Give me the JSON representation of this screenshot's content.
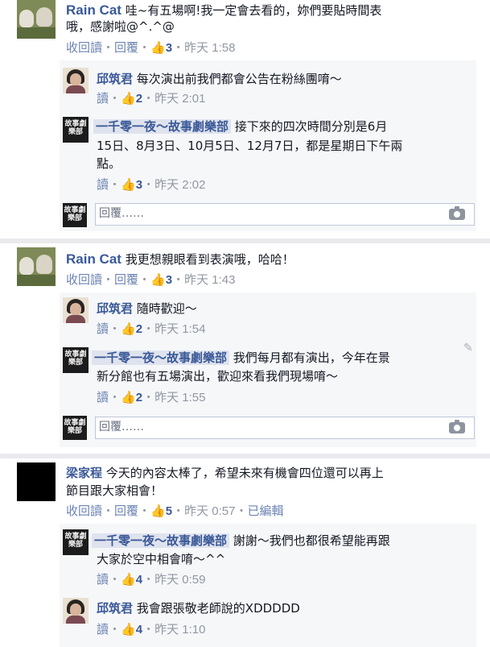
{
  "labels": {
    "reply_link": "回覆",
    "read": "讀",
    "receipt_prefix": "收回讀",
    "dot": "・",
    "edited": "已編輯",
    "reply_placeholder": "回覆……",
    "pencil_icon": "pencil-icon",
    "camera_icon": "camera-icon",
    "like_icon": "thumbs-up-icon"
  },
  "logo_text": "故事劇樂部",
  "threads": [
    {
      "author": "Rain Cat",
      "text_line1": "哇~有五場啊!我一定會去看的，妳們要貼時間表",
      "text_line2": "哦，感謝啦@^.^@",
      "likes": "3",
      "time": "昨天 1:58",
      "replies": [
        {
          "author": "邱筑君",
          "text": "每次演出前我們都會公告在粉絲團唷～",
          "likes": "2",
          "time": "昨天 2:01"
        },
        {
          "author": "一千零一夜～故事劇樂部",
          "text_line1": "接下來的四次時間分別是6月",
          "text_line2": "15日、8月3日、10月5日、12月7日，都是星期日下午兩",
          "text_line3": "點。",
          "likes": "3",
          "time": "昨天 2:02"
        }
      ]
    },
    {
      "author": "Rain Cat",
      "text_line1": "我更想親眼看到表演哦，哈哈！",
      "likes": "3",
      "time": "昨天 1:43",
      "replies": [
        {
          "author": "邱筑君",
          "text": "隨時歡迎～",
          "likes": "2",
          "time": "昨天 1:54"
        },
        {
          "author": "一千零一夜～故事劇樂部",
          "text_line1": "我們每月都有演出，今年在景",
          "text_line2": "新分館也有五場演出，歡迎來看我們現場唷～",
          "likes": "2",
          "time": "昨天 1:55"
        }
      ]
    },
    {
      "author": "梁家程",
      "text_line1": "今天的內容太棒了，希望未來有機會四位還可以再上",
      "text_line2": "節目跟大家相會！",
      "likes": "5",
      "time": "昨天 0:57",
      "replies": [
        {
          "author": "一千零一夜～故事劇樂部",
          "text_line1": "謝謝～我們也都很希望能再跟",
          "text_line2": "大家於空中相會唷～^^",
          "likes": "4",
          "time": "昨天 0:59"
        },
        {
          "author": "邱筑君",
          "text": "我會跟張敬老師說的XDDDDD",
          "likes": "4",
          "time": "昨天 1:10"
        }
      ]
    }
  ]
}
